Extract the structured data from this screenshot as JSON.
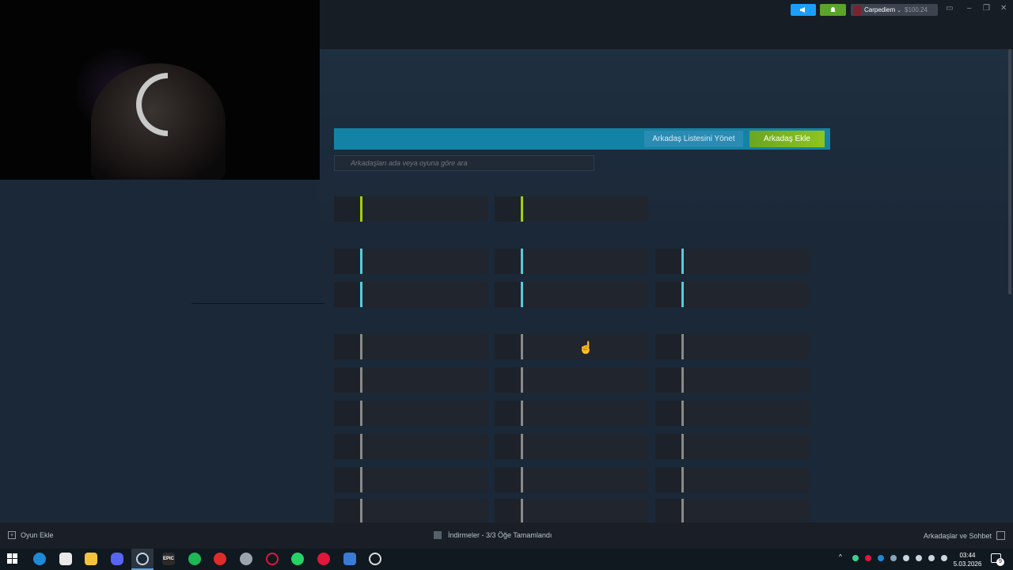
{
  "titlebar": {
    "username": "Carpediem",
    "balance": "$100.24"
  },
  "friends": {
    "manage_button": "Arkadaş Listesini Yönet",
    "add_button": "Arkadaş Ekle",
    "search_placeholder": "Arkadaşları ada veya oyuna göre ara"
  },
  "bottombar": {
    "add_game": "Oyun Ekle",
    "downloads": "İndirmeler - 3/3 Öğe Tamamlandı",
    "friends_chat": "Arkadaşlar ve Sohbet"
  },
  "taskbar": {
    "time": "03:44",
    "date": "5.03.2026",
    "notification_count": "9",
    "epic_label": "EPIC"
  },
  "colors": {
    "header_blue": "#1383a5",
    "add_green": "#8dc51f",
    "status_ingame": "#a4d007",
    "status_online": "#57cbde",
    "status_offline": "#898989"
  }
}
